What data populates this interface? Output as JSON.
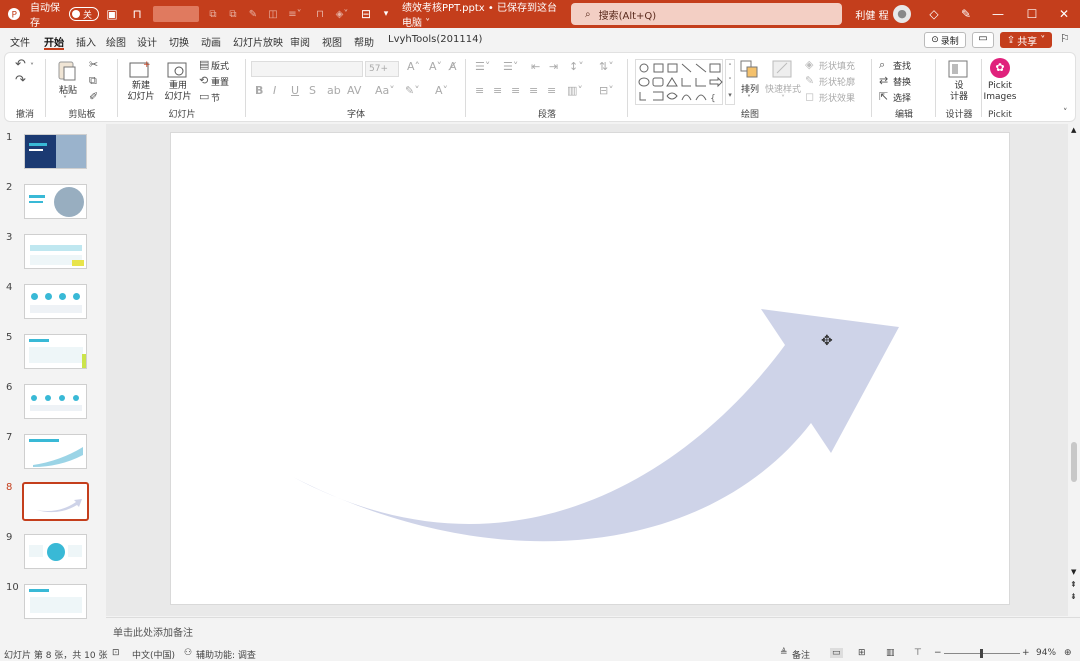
{
  "titlebar": {
    "autosave_label": "自动保存",
    "autosave_state": "关",
    "filename": "绩效考核PPT.pptx • 已保存到这台电脑 ˅",
    "search_placeholder": "搜索(Alt+Q)",
    "user_name": "利健 程"
  },
  "menu": {
    "tabs": [
      "文件",
      "开始",
      "插入",
      "绘图",
      "设计",
      "切换",
      "动画",
      "幻灯片放映",
      "审阅",
      "视图",
      "帮助",
      "LvyhTools(201114)"
    ],
    "record_label": "录制",
    "share_label": "共享"
  },
  "ribbon": {
    "undo_group": "撤消",
    "clipboard_group": "剪贴板",
    "paste_label": "粘贴",
    "slides_group": "幻灯片",
    "new_slide_label": "新建\n幻灯片",
    "reuse_slide_label": "重用\n幻灯片",
    "layout_label": "版式",
    "reset_label": "重置",
    "section_label": "节",
    "font_group": "字体",
    "font_size": "57+",
    "paragraph_group": "段落",
    "drawing_group": "绘图",
    "arrange_label": "排列",
    "quick_styles_label": "快速样式",
    "shape_fill_label": "形状填充",
    "shape_outline_label": "形状轮廓",
    "shape_effects_label": "形状效果",
    "editing_group": "编辑",
    "find_label": "查找",
    "replace_label": "替换",
    "select_label": "选择",
    "designer_group": "设计器",
    "designer_label": "设\n计器",
    "pickit_group": "Pickit",
    "pickit_label": "Pickit\nImages"
  },
  "thumbnails": [
    {
      "num": "1"
    },
    {
      "num": "2"
    },
    {
      "num": "3"
    },
    {
      "num": "4"
    },
    {
      "num": "5"
    },
    {
      "num": "6"
    },
    {
      "num": "7"
    },
    {
      "num": "8"
    },
    {
      "num": "9"
    },
    {
      "num": "10"
    }
  ],
  "selected_slide": 8,
  "notes_placeholder": "单击此处添加备注",
  "status": {
    "slide_info": "幻灯片 第 8 张，共 10 张",
    "language": "中文(中国)",
    "accessibility": "辅助功能: 调查",
    "notes_btn": "备注",
    "zoom": "94%",
    "zoom_fraction": 0.47
  },
  "colors": {
    "accent": "#c43e1c",
    "arrow_fill": "#ced3e8",
    "thumb_teal": "#39b9d6"
  }
}
